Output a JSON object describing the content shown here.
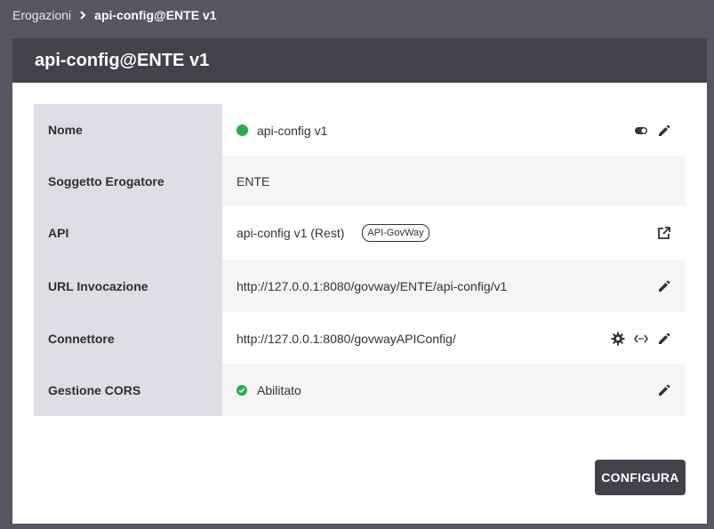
{
  "breadcrumb": {
    "parent": "Erogazioni",
    "current": "api-config@ENTE v1"
  },
  "panel": {
    "title": "api-config@ENTE v1"
  },
  "rows": {
    "nome": {
      "label": "Nome",
      "value": "api-config v1",
      "status_color": "#22b14c"
    },
    "soggetto": {
      "label": "Soggetto Erogatore",
      "value": "ENTE"
    },
    "api": {
      "label": "API",
      "value": "api-config v1 (Rest)",
      "tag": "API-GovWay"
    },
    "url": {
      "label": "URL Invocazione",
      "value": "http://127.0.0.1:8080/govway/ENTE/api-config/v1"
    },
    "connettore": {
      "label": "Connettore",
      "value": "http://127.0.0.1:8080/govwayAPIConfig/"
    },
    "cors": {
      "label": "Gestione CORS",
      "value": "Abilitato"
    }
  },
  "buttons": {
    "configura": "CONFIGURA"
  },
  "icons": {
    "toggle": "toggle-icon",
    "edit": "pencil-icon",
    "external": "external-link-icon",
    "gear": "gear-icon",
    "code": "code-arrows-icon",
    "check": "check-circle-icon",
    "chevron": "chevron-right-icon"
  }
}
